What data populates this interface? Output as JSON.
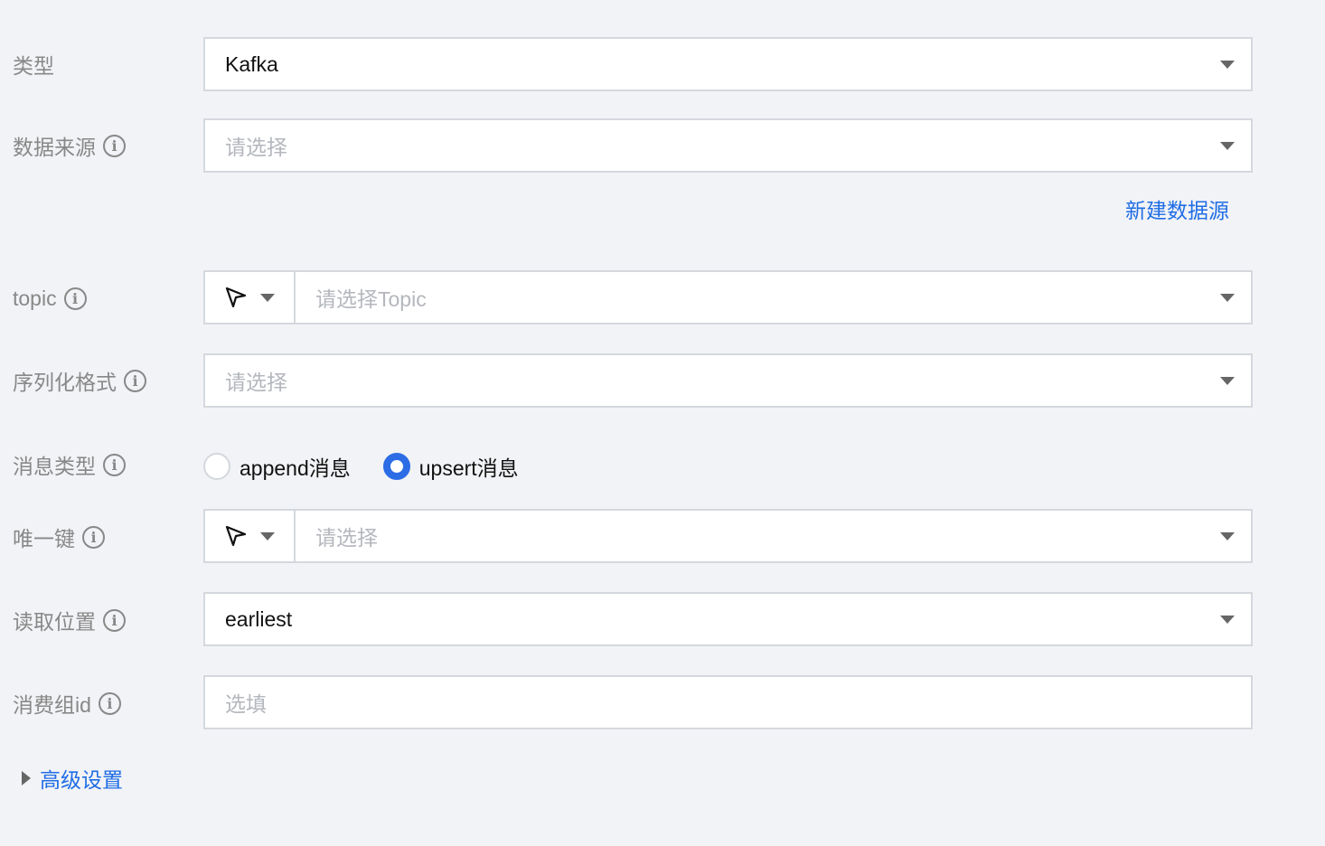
{
  "form": {
    "type": {
      "label": "类型",
      "value": "Kafka"
    },
    "datasource": {
      "label": "数据来源",
      "placeholder": "请选择",
      "new_link": "新建数据源"
    },
    "topic": {
      "label": "topic",
      "placeholder": "请选择Topic"
    },
    "serialization": {
      "label": "序列化格式",
      "placeholder": "请选择"
    },
    "message_type": {
      "label": "消息类型",
      "options": [
        {
          "label": "append消息",
          "selected": false
        },
        {
          "label": "upsert消息",
          "selected": true
        }
      ]
    },
    "unique_key": {
      "label": "唯一键",
      "placeholder": "请选择"
    },
    "read_position": {
      "label": "读取位置",
      "value": "earliest"
    },
    "consumer_group": {
      "label": "消费组id",
      "placeholder": "选填"
    },
    "advanced": {
      "label": "高级设置"
    }
  },
  "icons": {
    "info": "info-icon",
    "dropdown": "chevron-down-icon",
    "cursor": "cursor-arrow-icon",
    "expand": "caret-right-icon"
  },
  "colors": {
    "background": "#f2f3f6",
    "link": "#1f6de5",
    "radio_selected": "#2c6de6",
    "label": "#888888",
    "border": "#d4d8de"
  }
}
